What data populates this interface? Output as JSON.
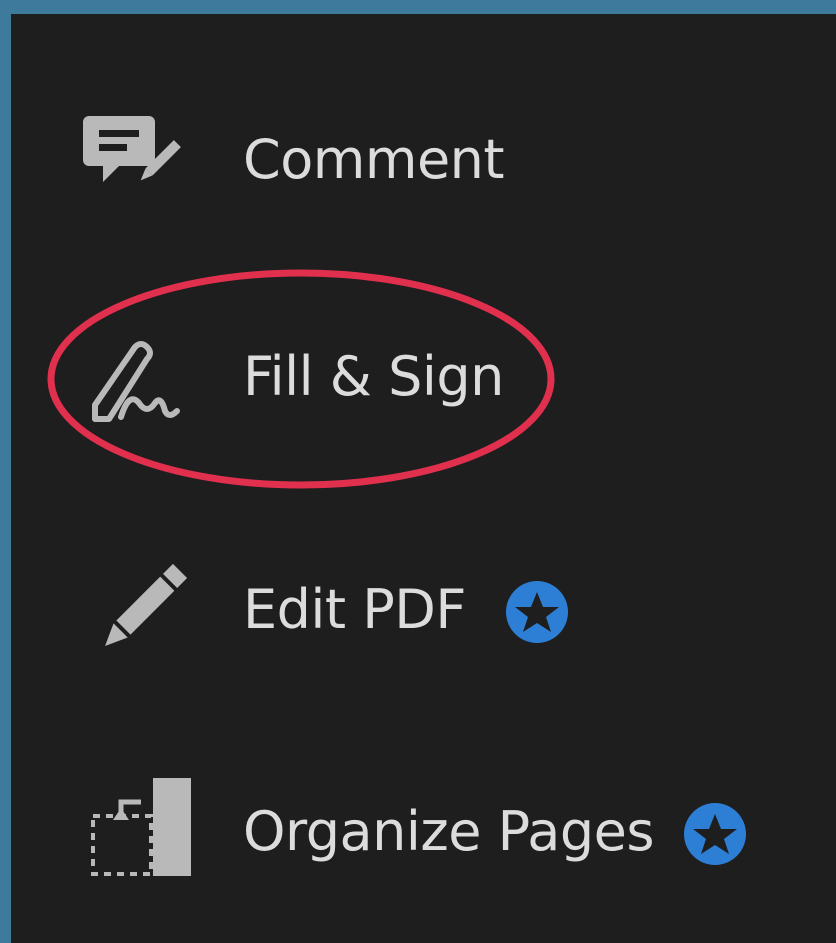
{
  "tools": [
    {
      "label": "Comment",
      "icon": "comment-icon",
      "premium": false
    },
    {
      "label": "Fill & Sign",
      "icon": "fill-sign-icon",
      "premium": false,
      "highlighted": true
    },
    {
      "label": "Edit PDF",
      "icon": "edit-pencil-icon",
      "premium": true
    },
    {
      "label": "Organize Pages",
      "icon": "organize-pages-icon",
      "premium": true
    }
  ],
  "colors": {
    "panel_background": "#1e1e1e",
    "outer_background": "#3d7a9b",
    "text": "#dcdcdc",
    "icon": "#b9b9b9",
    "premium_badge": "#2d7fd6",
    "highlight_circle": "#e0304e"
  }
}
